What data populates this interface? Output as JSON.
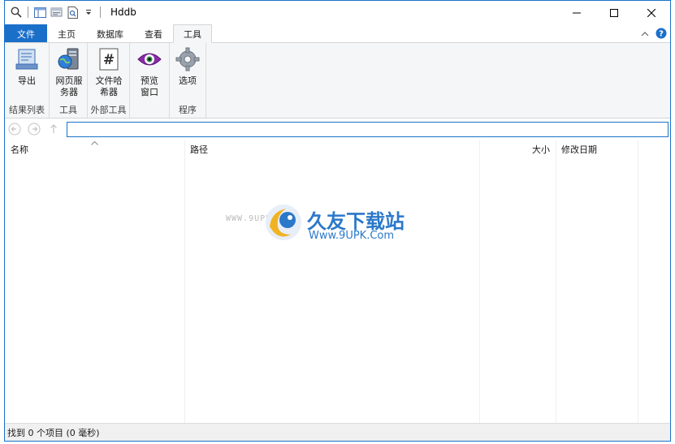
{
  "window": {
    "title": "Hddb"
  },
  "tabs": [
    {
      "label": "文件"
    },
    {
      "label": "主页"
    },
    {
      "label": "数据库"
    },
    {
      "label": "查看"
    },
    {
      "label": "工具"
    }
  ],
  "active_tab": "工具",
  "ribbon": {
    "groups": [
      {
        "label": "结果列表",
        "buttons": [
          {
            "label": "导出",
            "icon": "export-icon"
          }
        ]
      },
      {
        "label": "工具",
        "buttons": [
          {
            "label": "网页服务器",
            "icon": "web-server-icon"
          }
        ]
      },
      {
        "label": "外部工具",
        "buttons": [
          {
            "label": "文件哈希器",
            "icon": "hash-icon"
          },
          {
            "label": "预览窗口",
            "icon": "eye-icon"
          }
        ]
      },
      {
        "label": "程序",
        "buttons": [
          {
            "label": "选项",
            "icon": "gear-icon"
          }
        ]
      }
    ]
  },
  "address": {
    "value": ""
  },
  "columns": [
    {
      "label": "名称"
    },
    {
      "label": "路径"
    },
    {
      "label": "大小"
    },
    {
      "label": "修改日期"
    }
  ],
  "watermark": {
    "small": "WWW.9UPK.COM",
    "cn": "久友下载站",
    "en": "Www.9UPK.Com"
  },
  "status": {
    "text": "找到 0 个项目 (0 毫秒)"
  },
  "colors": {
    "accent": "#1a6fc9",
    "ribbon_bg": "#f5f6f7",
    "watermark": "#2b78c9"
  }
}
